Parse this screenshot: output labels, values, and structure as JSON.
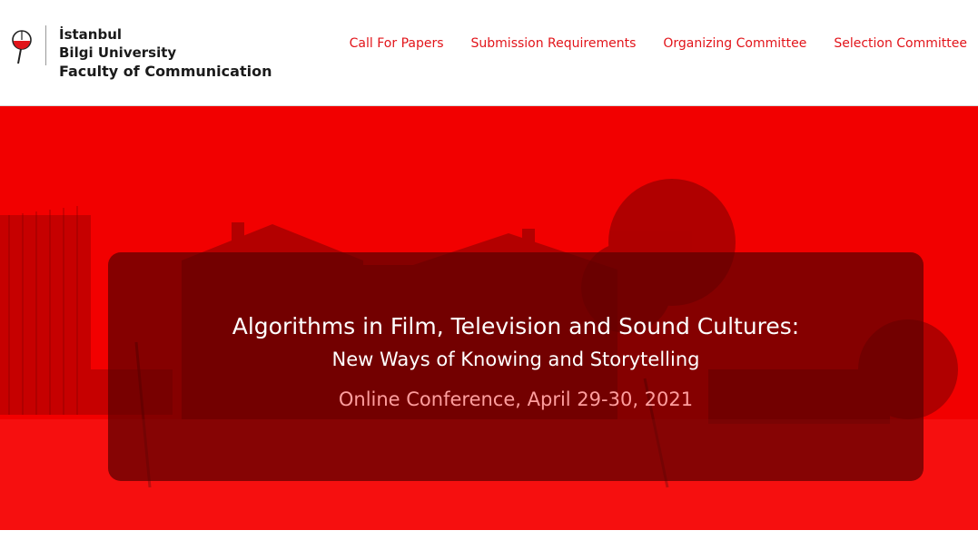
{
  "header": {
    "logo": {
      "line1": "İstanbul",
      "line2": "Bilgi University",
      "line3": "Faculty of Communication"
    },
    "nav": [
      {
        "label": "Call For Papers"
      },
      {
        "label": "Submission Requirements"
      },
      {
        "label": "Organizing Committee"
      },
      {
        "label": "Selection Committee"
      }
    ]
  },
  "hero": {
    "title": "Algorithms in Film, Television and Sound Cultures:",
    "subtitle": "New Ways of Knowing and Storytelling",
    "conference": "Online Conference, April 29-30, 2021"
  },
  "colors": {
    "accent": "#e2141a",
    "hero_background": "#f20000",
    "overlay": "#5a0000",
    "conference_text": "#ff9e9e"
  },
  "icons": {
    "logo": "university-logo-icon"
  }
}
